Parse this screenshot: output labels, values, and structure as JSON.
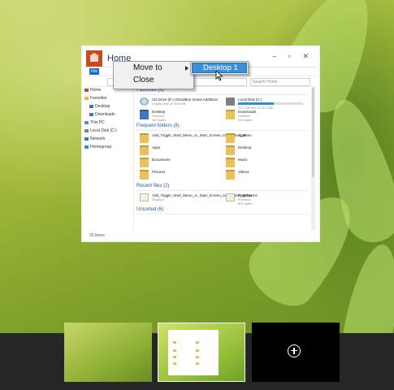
{
  "window": {
    "title": "Home",
    "file_tab": "File",
    "search_placeholder": "Search Home",
    "status": "20 items"
  },
  "nav": {
    "items": [
      "Home",
      "Favorites",
      "Desktop",
      "Downloads",
      "This PC",
      "Local Disk (C:)",
      "Network",
      "Homegroup"
    ]
  },
  "sections": {
    "favorites": "Favorites (4)",
    "frequent": "Frequent folders (8)",
    "recent": "Recent files (2)",
    "unsorted": "Unsorted (6)"
  },
  "favorites": [
    {
      "name": "CD Drive (E:) VirtualBox Guest Additions",
      "sub": "0 bytes free of 55.5 MB"
    },
    {
      "name": "Local Disk (C:)",
      "sub": "11.2 GB free of 24.6 GB",
      "used": 0.55
    },
    {
      "name": "Desktop",
      "sub": "Shortcut",
      "sub2": "480 bytes"
    },
    {
      "name": "Downloads",
      "sub": "Shortcut",
      "sub2": "910 bytes"
    }
  ],
  "frequent": [
    {
      "name": "Add_Toggle_Start_Menu_or_Start_Screen_to_Context_Menu"
    },
    {
      "name": "Apps"
    },
    {
      "name": "Apps"
    },
    {
      "name": "Desktop"
    },
    {
      "name": "Documents"
    },
    {
      "name": "Music"
    },
    {
      "name": "Pictures"
    },
    {
      "name": "Videos"
    }
  ],
  "recent": [
    {
      "name": "Add_Toggle_Start_Menu_or_Start_Screen_to_Context_Menu",
      "sub": "Shortcut"
    },
    {
      "name": "PagCharms",
      "sub": "Shortcut",
      "sub2": "807 bytes"
    }
  ],
  "context_menu": {
    "move_to": "Move to",
    "close": "Close"
  },
  "submenu": {
    "item": "Desktop 1"
  },
  "taskview": {
    "thumbs": [
      "Desktop 1 thumbnail",
      "Desktop 2 thumbnail"
    ]
  },
  "colors": {
    "accent": "#3b8fd9",
    "app_tile": "#c94a1c",
    "taskbar": "#262626"
  }
}
